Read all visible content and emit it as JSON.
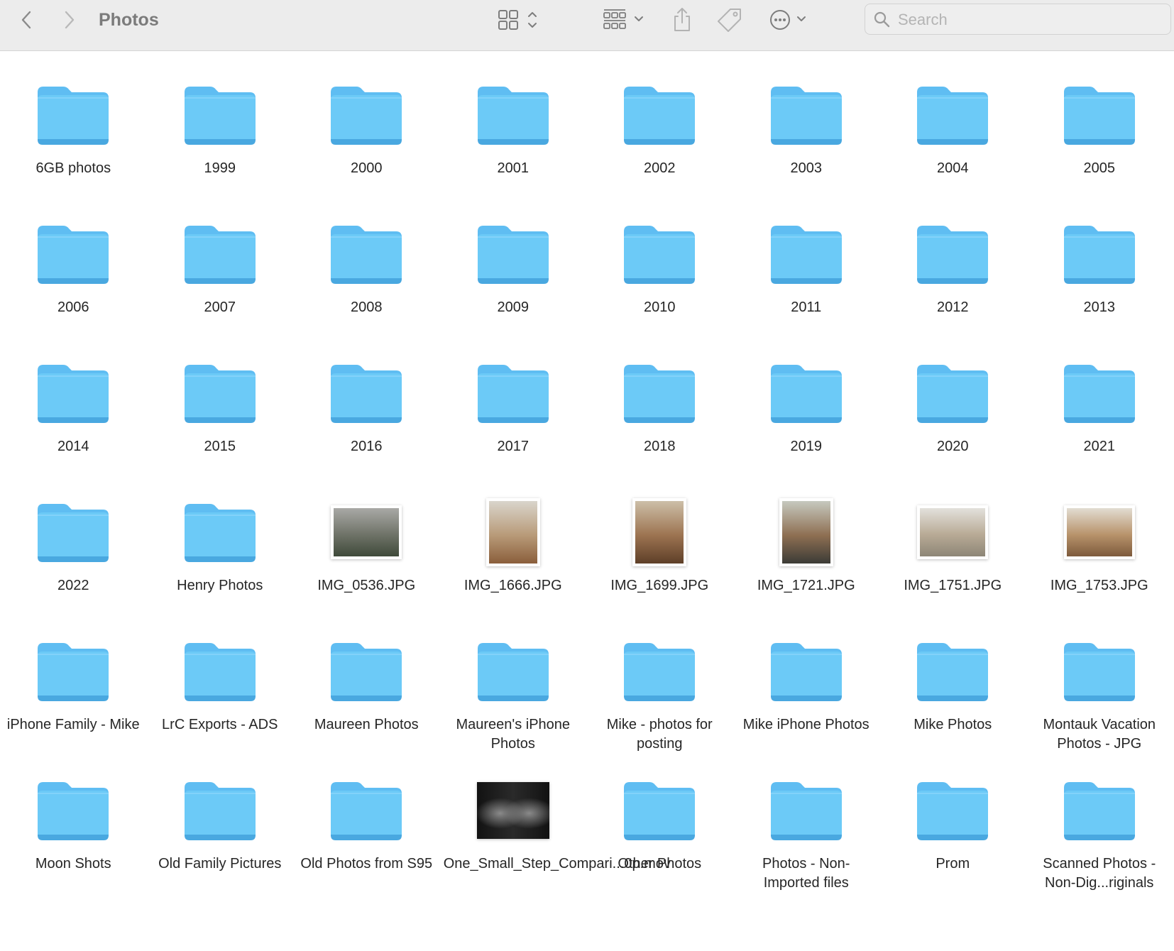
{
  "window": {
    "title": "Photos",
    "search_placeholder": "Search"
  },
  "toolbar_icons": {
    "back": "chevron-left-icon",
    "forward": "chevron-right-icon",
    "view": "grid-view-icon",
    "group": "group-by-icon",
    "share": "share-icon",
    "tag": "tag-icon",
    "more": "ellipsis-circle-icon",
    "search": "magnifier-icon"
  },
  "colors": {
    "folder": "#6ccaf7",
    "folder_tab": "#5fbdf2",
    "folder_edge": "#49a8e0",
    "toolbar_bg": "#ececec"
  },
  "items": [
    {
      "name": "6GB photos",
      "kind": "folder"
    },
    {
      "name": "1999",
      "kind": "folder"
    },
    {
      "name": "2000",
      "kind": "folder"
    },
    {
      "name": "2001",
      "kind": "folder"
    },
    {
      "name": "2002",
      "kind": "folder"
    },
    {
      "name": "2003",
      "kind": "folder"
    },
    {
      "name": "2004",
      "kind": "folder"
    },
    {
      "name": "2005",
      "kind": "folder"
    },
    {
      "name": "2006",
      "kind": "folder"
    },
    {
      "name": "2007",
      "kind": "folder"
    },
    {
      "name": "2008",
      "kind": "folder"
    },
    {
      "name": "2009",
      "kind": "folder"
    },
    {
      "name": "2010",
      "kind": "folder"
    },
    {
      "name": "2011",
      "kind": "folder"
    },
    {
      "name": "2012",
      "kind": "folder"
    },
    {
      "name": "2013",
      "kind": "folder"
    },
    {
      "name": "2014",
      "kind": "folder"
    },
    {
      "name": "2015",
      "kind": "folder"
    },
    {
      "name": "2016",
      "kind": "folder"
    },
    {
      "name": "2017",
      "kind": "folder"
    },
    {
      "name": "2018",
      "kind": "folder"
    },
    {
      "name": "2019",
      "kind": "folder"
    },
    {
      "name": "2020",
      "kind": "folder"
    },
    {
      "name": "2021",
      "kind": "folder"
    },
    {
      "name": "2022",
      "kind": "folder"
    },
    {
      "name": "Henry Photos",
      "kind": "folder"
    },
    {
      "name": "IMG_0536.JPG",
      "kind": "image",
      "orientation": "landscape",
      "colors": [
        "#a9a9a6",
        "#6f7368",
        "#3f4a3a"
      ]
    },
    {
      "name": "IMG_1666.JPG",
      "kind": "image",
      "orientation": "portrait",
      "colors": [
        "#d9d5cc",
        "#b89a78",
        "#8a5e3b"
      ]
    },
    {
      "name": "IMG_1699.JPG",
      "kind": "image",
      "orientation": "portrait",
      "colors": [
        "#cdbfa8",
        "#9c7350",
        "#5e3f28"
      ]
    },
    {
      "name": "IMG_1721.JPG",
      "kind": "image",
      "orientation": "portrait",
      "colors": [
        "#c6c9bf",
        "#8e6f52",
        "#3b3b36"
      ]
    },
    {
      "name": "IMG_1751.JPG",
      "kind": "image",
      "orientation": "landscape",
      "colors": [
        "#e3e1dc",
        "#b8aa95",
        "#8d8677"
      ]
    },
    {
      "name": "IMG_1753.JPG",
      "kind": "image",
      "orientation": "landscape",
      "colors": [
        "#e2ddd2",
        "#b8936b",
        "#7d5a3c"
      ]
    },
    {
      "name": "iPhone Family - Mike",
      "kind": "folder"
    },
    {
      "name": "LrC Exports - ADS",
      "kind": "folder"
    },
    {
      "name": "Maureen Photos",
      "kind": "folder"
    },
    {
      "name": "Maureen's iPhone Photos",
      "kind": "folder"
    },
    {
      "name": "Mike - photos for posting",
      "kind": "folder"
    },
    {
      "name": "Mike iPhone Photos",
      "kind": "folder"
    },
    {
      "name": "Mike Photos",
      "kind": "folder"
    },
    {
      "name": "Montauk Vacation Photos - JPG",
      "kind": "folder"
    },
    {
      "name": "Moon Shots",
      "kind": "folder"
    },
    {
      "name": "Old Family Pictures",
      "kind": "folder"
    },
    {
      "name": "Old Photos from S95",
      "kind": "folder"
    },
    {
      "name": "One_Small_Step_Compari...0p.mov",
      "kind": "video",
      "colors": [
        "#121212",
        "#8a8a8a",
        "#2a2a2a"
      ]
    },
    {
      "name": "Other Photos",
      "kind": "folder"
    },
    {
      "name": "Photos - Non-Imported files",
      "kind": "folder"
    },
    {
      "name": "Prom",
      "kind": "folder"
    },
    {
      "name": "Scanned Photos - Non-Dig...riginals",
      "kind": "folder"
    }
  ]
}
